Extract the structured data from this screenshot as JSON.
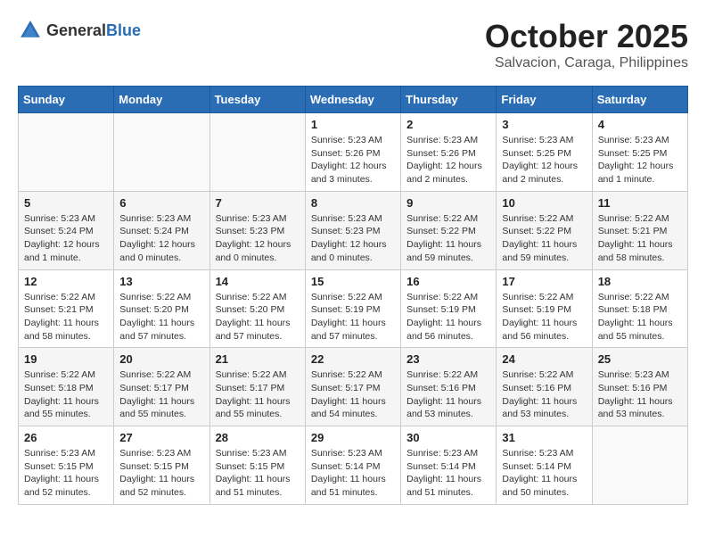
{
  "header": {
    "logo_general": "General",
    "logo_blue": "Blue",
    "month_year": "October 2025",
    "location": "Salvacion, Caraga, Philippines"
  },
  "weekdays": [
    "Sunday",
    "Monday",
    "Tuesday",
    "Wednesday",
    "Thursday",
    "Friday",
    "Saturday"
  ],
  "weeks": [
    [
      {
        "day": "",
        "details": ""
      },
      {
        "day": "",
        "details": ""
      },
      {
        "day": "",
        "details": ""
      },
      {
        "day": "1",
        "details": "Sunrise: 5:23 AM\nSunset: 5:26 PM\nDaylight: 12 hours\nand 3 minutes."
      },
      {
        "day": "2",
        "details": "Sunrise: 5:23 AM\nSunset: 5:26 PM\nDaylight: 12 hours\nand 2 minutes."
      },
      {
        "day": "3",
        "details": "Sunrise: 5:23 AM\nSunset: 5:25 PM\nDaylight: 12 hours\nand 2 minutes."
      },
      {
        "day": "4",
        "details": "Sunrise: 5:23 AM\nSunset: 5:25 PM\nDaylight: 12 hours\nand 1 minute."
      }
    ],
    [
      {
        "day": "5",
        "details": "Sunrise: 5:23 AM\nSunset: 5:24 PM\nDaylight: 12 hours\nand 1 minute."
      },
      {
        "day": "6",
        "details": "Sunrise: 5:23 AM\nSunset: 5:24 PM\nDaylight: 12 hours\nand 0 minutes."
      },
      {
        "day": "7",
        "details": "Sunrise: 5:23 AM\nSunset: 5:23 PM\nDaylight: 12 hours\nand 0 minutes."
      },
      {
        "day": "8",
        "details": "Sunrise: 5:23 AM\nSunset: 5:23 PM\nDaylight: 12 hours\nand 0 minutes."
      },
      {
        "day": "9",
        "details": "Sunrise: 5:22 AM\nSunset: 5:22 PM\nDaylight: 11 hours\nand 59 minutes."
      },
      {
        "day": "10",
        "details": "Sunrise: 5:22 AM\nSunset: 5:22 PM\nDaylight: 11 hours\nand 59 minutes."
      },
      {
        "day": "11",
        "details": "Sunrise: 5:22 AM\nSunset: 5:21 PM\nDaylight: 11 hours\nand 58 minutes."
      }
    ],
    [
      {
        "day": "12",
        "details": "Sunrise: 5:22 AM\nSunset: 5:21 PM\nDaylight: 11 hours\nand 58 minutes."
      },
      {
        "day": "13",
        "details": "Sunrise: 5:22 AM\nSunset: 5:20 PM\nDaylight: 11 hours\nand 57 minutes."
      },
      {
        "day": "14",
        "details": "Sunrise: 5:22 AM\nSunset: 5:20 PM\nDaylight: 11 hours\nand 57 minutes."
      },
      {
        "day": "15",
        "details": "Sunrise: 5:22 AM\nSunset: 5:19 PM\nDaylight: 11 hours\nand 57 minutes."
      },
      {
        "day": "16",
        "details": "Sunrise: 5:22 AM\nSunset: 5:19 PM\nDaylight: 11 hours\nand 56 minutes."
      },
      {
        "day": "17",
        "details": "Sunrise: 5:22 AM\nSunset: 5:19 PM\nDaylight: 11 hours\nand 56 minutes."
      },
      {
        "day": "18",
        "details": "Sunrise: 5:22 AM\nSunset: 5:18 PM\nDaylight: 11 hours\nand 55 minutes."
      }
    ],
    [
      {
        "day": "19",
        "details": "Sunrise: 5:22 AM\nSunset: 5:18 PM\nDaylight: 11 hours\nand 55 minutes."
      },
      {
        "day": "20",
        "details": "Sunrise: 5:22 AM\nSunset: 5:17 PM\nDaylight: 11 hours\nand 55 minutes."
      },
      {
        "day": "21",
        "details": "Sunrise: 5:22 AM\nSunset: 5:17 PM\nDaylight: 11 hours\nand 55 minutes."
      },
      {
        "day": "22",
        "details": "Sunrise: 5:22 AM\nSunset: 5:17 PM\nDaylight: 11 hours\nand 54 minutes."
      },
      {
        "day": "23",
        "details": "Sunrise: 5:22 AM\nSunset: 5:16 PM\nDaylight: 11 hours\nand 53 minutes."
      },
      {
        "day": "24",
        "details": "Sunrise: 5:22 AM\nSunset: 5:16 PM\nDaylight: 11 hours\nand 53 minutes."
      },
      {
        "day": "25",
        "details": "Sunrise: 5:23 AM\nSunset: 5:16 PM\nDaylight: 11 hours\nand 53 minutes."
      }
    ],
    [
      {
        "day": "26",
        "details": "Sunrise: 5:23 AM\nSunset: 5:15 PM\nDaylight: 11 hours\nand 52 minutes."
      },
      {
        "day": "27",
        "details": "Sunrise: 5:23 AM\nSunset: 5:15 PM\nDaylight: 11 hours\nand 52 minutes."
      },
      {
        "day": "28",
        "details": "Sunrise: 5:23 AM\nSunset: 5:15 PM\nDaylight: 11 hours\nand 51 minutes."
      },
      {
        "day": "29",
        "details": "Sunrise: 5:23 AM\nSunset: 5:14 PM\nDaylight: 11 hours\nand 51 minutes."
      },
      {
        "day": "30",
        "details": "Sunrise: 5:23 AM\nSunset: 5:14 PM\nDaylight: 11 hours\nand 51 minutes."
      },
      {
        "day": "31",
        "details": "Sunrise: 5:23 AM\nSunset: 5:14 PM\nDaylight: 11 hours\nand 50 minutes."
      },
      {
        "day": "",
        "details": ""
      }
    ]
  ]
}
